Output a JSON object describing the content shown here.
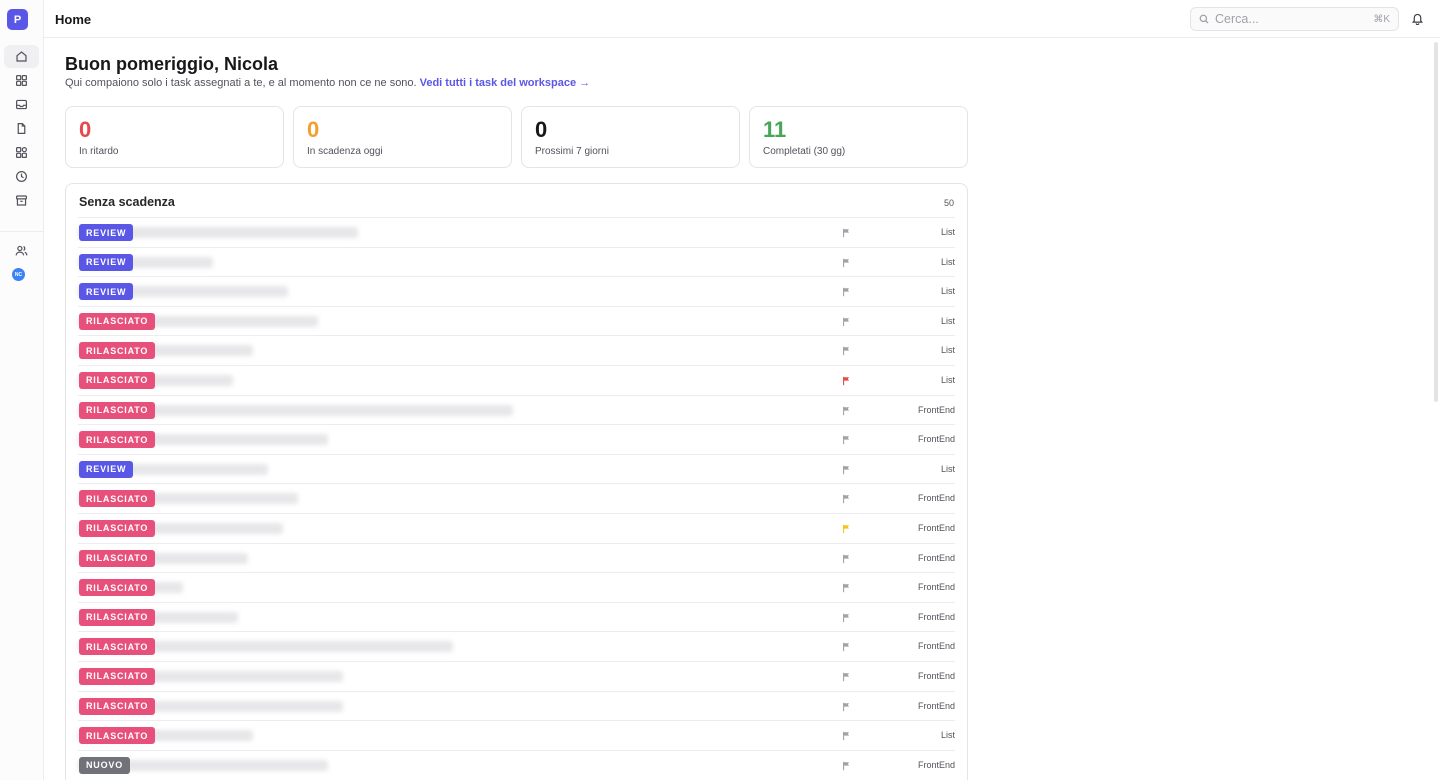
{
  "app": {
    "logo_letter": "P",
    "page_title": "Home"
  },
  "sidebar": {
    "items": [
      {
        "name": "home-icon",
        "active": true
      },
      {
        "name": "grid-icon",
        "active": false
      },
      {
        "name": "inbox-icon",
        "active": false
      },
      {
        "name": "file-icon",
        "active": false
      },
      {
        "name": "apps-icon",
        "active": false
      },
      {
        "name": "clock-icon",
        "active": false
      },
      {
        "name": "archive-icon",
        "active": false
      },
      {
        "name": "users-icon",
        "active": false
      }
    ],
    "avatar_initials": "NC"
  },
  "search": {
    "placeholder": "Cerca...",
    "shortcut": "⌘K"
  },
  "main": {
    "greeting": "Buon pomeriggio, Nicola",
    "subtitle": "Qui compaiono solo i task assegnati a te, e al momento non ce ne sono.",
    "workspace_link": "Vedi tutti i task del workspace →"
  },
  "stats": [
    {
      "value": "0",
      "label": "In ritardo",
      "color": "#e5484d"
    },
    {
      "value": "0",
      "label": "In scadenza oggi",
      "color": "#f59e2e"
    },
    {
      "value": "0",
      "label": "Prossimi 7 giorni",
      "color": "#18181b"
    },
    {
      "value": "11",
      "label": "Completati (30 gg)",
      "color": "#46a758"
    }
  ],
  "panel": {
    "title": "Senza scadenza",
    "count": "50",
    "rows": [
      {
        "status": "REVIEW",
        "kind": "review",
        "project": "List",
        "flag": "#a1a1aa"
      },
      {
        "status": "REVIEW",
        "kind": "review",
        "project": "List",
        "flag": "#a1a1aa"
      },
      {
        "status": "REVIEW",
        "kind": "review",
        "project": "List",
        "flag": "#a1a1aa"
      },
      {
        "status": "RILASCIATO",
        "kind": "rilasciato",
        "project": "List",
        "flag": "#a1a1aa"
      },
      {
        "status": "RILASCIATO",
        "kind": "rilasciato",
        "project": "List",
        "flag": "#a1a1aa"
      },
      {
        "status": "RILASCIATO",
        "kind": "rilasciato",
        "project": "List",
        "flag": "#e5484d"
      },
      {
        "status": "RILASCIATO",
        "kind": "rilasciato",
        "project": "FrontEnd",
        "flag": "#a1a1aa"
      },
      {
        "status": "RILASCIATO",
        "kind": "rilasciato",
        "project": "FrontEnd",
        "flag": "#a1a1aa"
      },
      {
        "status": "REVIEW",
        "kind": "review",
        "project": "List",
        "flag": "#a1a1aa"
      },
      {
        "status": "RILASCIATO",
        "kind": "rilasciato",
        "project": "FrontEnd",
        "flag": "#a1a1aa"
      },
      {
        "status": "RILASCIATO",
        "kind": "rilasciato",
        "project": "FrontEnd",
        "flag": "#f5c518"
      },
      {
        "status": "RILASCIATO",
        "kind": "rilasciato",
        "project": "FrontEnd",
        "flag": "#a1a1aa"
      },
      {
        "status": "RILASCIATO",
        "kind": "rilasciato",
        "project": "FrontEnd",
        "flag": "#a1a1aa"
      },
      {
        "status": "RILASCIATO",
        "kind": "rilasciato",
        "project": "FrontEnd",
        "flag": "#a1a1aa"
      },
      {
        "status": "RILASCIATO",
        "kind": "rilasciato",
        "project": "FrontEnd",
        "flag": "#a1a1aa"
      },
      {
        "status": "RILASCIATO",
        "kind": "rilasciato",
        "project": "FrontEnd",
        "flag": "#a1a1aa"
      },
      {
        "status": "RILASCIATO",
        "kind": "rilasciato",
        "project": "FrontEnd",
        "flag": "#a1a1aa"
      },
      {
        "status": "RILASCIATO",
        "kind": "rilasciato",
        "project": "List",
        "flag": "#a1a1aa"
      },
      {
        "status": "NUOVO",
        "kind": "nuovo",
        "project": "FrontEnd",
        "flag": "#a1a1aa"
      }
    ]
  }
}
